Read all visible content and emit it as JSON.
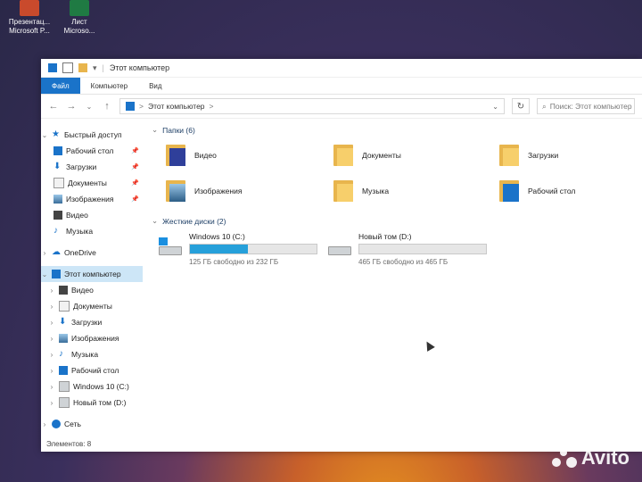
{
  "desktop": {
    "icons": [
      {
        "line1": "Презентац...",
        "line2": "Microsoft P...",
        "color": "#c94a2c"
      },
      {
        "line1": "Лист",
        "line2": "Microso...",
        "color": "#1f7a43"
      }
    ]
  },
  "window": {
    "title": "Этот компьютер",
    "ribbon_tabs": [
      "Файл",
      "Компьютер",
      "Вид"
    ],
    "address": {
      "path": "Этот компьютер",
      "separator": ">"
    },
    "search_placeholder": "Поиск: Этот компьютер"
  },
  "nav": {
    "quick_access": "Быстрый доступ",
    "quick_items": [
      {
        "label": "Рабочий стол",
        "icon": "desktop-icon",
        "pinned": true
      },
      {
        "label": "Загрузки",
        "icon": "downloads-icon",
        "pinned": true
      },
      {
        "label": "Документы",
        "icon": "documents-icon",
        "pinned": true
      },
      {
        "label": "Изображения",
        "icon": "pictures-icon",
        "pinned": true
      },
      {
        "label": "Видео",
        "icon": "video-icon",
        "pinned": false
      },
      {
        "label": "Музыка",
        "icon": "music-icon",
        "pinned": false
      }
    ],
    "onedrive": "OneDrive",
    "this_pc": "Этот компьютер",
    "pc_items": [
      {
        "label": "Видео",
        "icon": "video-icon"
      },
      {
        "label": "Документы",
        "icon": "documents-icon"
      },
      {
        "label": "Загрузки",
        "icon": "downloads-icon"
      },
      {
        "label": "Изображения",
        "icon": "pictures-icon"
      },
      {
        "label": "Музыка",
        "icon": "music-icon"
      },
      {
        "label": "Рабочий стол",
        "icon": "desktop-icon"
      },
      {
        "label": "Windows 10 (C:)",
        "icon": "drive-c-icon"
      },
      {
        "label": "Новый том (D:)",
        "icon": "drive-d-icon"
      }
    ],
    "network": "Сеть"
  },
  "status": "Элементов: 8",
  "content": {
    "folders_header": "Папки (6)",
    "folders": [
      {
        "label": "Видео",
        "icon": "video-folder-icon"
      },
      {
        "label": "Документы",
        "icon": "documents-folder-icon"
      },
      {
        "label": "Загрузки",
        "icon": "downloads-folder-icon"
      },
      {
        "label": "Изображения",
        "icon": "pictures-folder-icon"
      },
      {
        "label": "Музыка",
        "icon": "music-folder-icon"
      },
      {
        "label": "Рабочий стол",
        "icon": "desktop-folder-icon"
      }
    ],
    "drives_header": "Жесткие диски (2)",
    "drives": [
      {
        "label": "Windows 10 (C:)",
        "free": "125 ГБ свободно из 232 ГБ",
        "used_fraction": 0.46
      },
      {
        "label": "Новый том (D:)",
        "free": "465 ГБ свободно из 465 ГБ",
        "used_fraction": 0.0
      }
    ]
  },
  "watermark": "Avito",
  "colors": {
    "accent": "#1a73c9",
    "bar_fill": "#26a0da",
    "selected": "#cde6f7",
    "folder": "#f7cf6b"
  }
}
